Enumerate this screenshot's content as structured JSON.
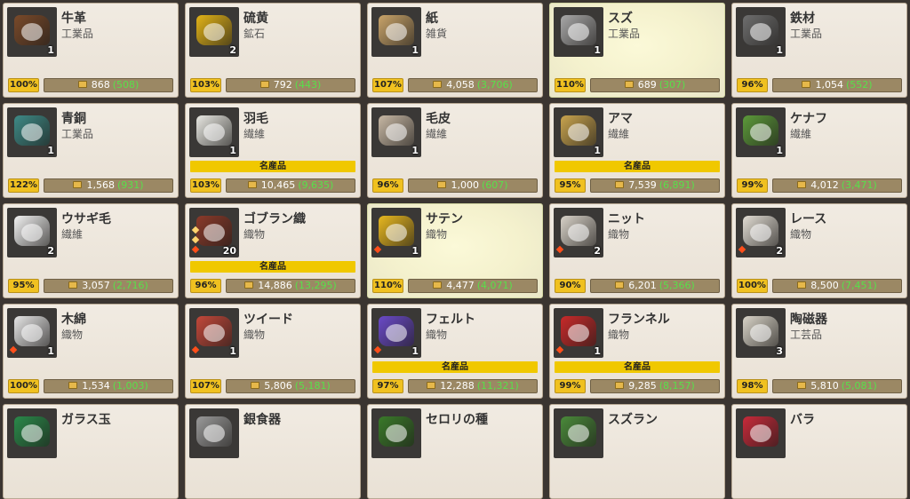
{
  "items": [
    {
      "name": "牛革",
      "category": "工業品",
      "qty": "1",
      "pct": "100%",
      "price": "868",
      "base": "(508)",
      "special": "",
      "highlight": false,
      "gems": 0,
      "color": "#7a4a2a"
    },
    {
      "name": "硫黄",
      "category": "鉱石",
      "qty": "2",
      "pct": "103%",
      "price": "792",
      "base": "(443)",
      "special": "",
      "highlight": false,
      "gems": 0,
      "color": "#e2b318"
    },
    {
      "name": "紙",
      "category": "雑貨",
      "qty": "1",
      "pct": "107%",
      "price": "4,058",
      "base": "(3,706)",
      "special": "",
      "highlight": false,
      "gems": 0,
      "color": "#c9a46a"
    },
    {
      "name": "スズ",
      "category": "工業品",
      "qty": "1",
      "pct": "110%",
      "price": "689",
      "base": "(307)",
      "special": "",
      "highlight": true,
      "gems": 0,
      "color": "#a8a8a8"
    },
    {
      "name": "鉄材",
      "category": "工業品",
      "qty": "1",
      "pct": "96%",
      "price": "1,054",
      "base": "(552)",
      "special": "",
      "highlight": false,
      "gems": 0,
      "color": "#6e6e6e"
    },
    {
      "name": "青銅",
      "category": "工業品",
      "qty": "1",
      "pct": "122%",
      "price": "1,568",
      "base": "(931)",
      "special": "",
      "highlight": false,
      "gems": 0,
      "color": "#3e8a86"
    },
    {
      "name": "羽毛",
      "category": "繊維",
      "qty": "1",
      "pct": "103%",
      "price": "10,465",
      "base": "(9,635)",
      "special": "名産品",
      "highlight": false,
      "gems": 0,
      "color": "#e8e8e2"
    },
    {
      "name": "毛皮",
      "category": "繊維",
      "qty": "1",
      "pct": "96%",
      "price": "1,000",
      "base": "(607)",
      "special": "",
      "highlight": false,
      "gems": 0,
      "color": "#c7b8a4"
    },
    {
      "name": "アマ",
      "category": "繊維",
      "qty": "1",
      "pct": "95%",
      "price": "7,539",
      "base": "(6,891)",
      "special": "名産品",
      "highlight": false,
      "gems": 0,
      "color": "#c9a44e"
    },
    {
      "name": "ケナフ",
      "category": "繊維",
      "qty": "1",
      "pct": "99%",
      "price": "4,012",
      "base": "(3,471)",
      "special": "",
      "highlight": false,
      "gems": 0,
      "color": "#5c9a3a"
    },
    {
      "name": "ウサギ毛",
      "category": "繊維",
      "qty": "2",
      "pct": "95%",
      "price": "3,057",
      "base": "(2,716)",
      "special": "",
      "highlight": false,
      "gems": 0,
      "color": "#f2f2f2"
    },
    {
      "name": "ゴブラン織",
      "category": "織物",
      "qty": "20",
      "pct": "96%",
      "price": "14,886",
      "base": "(13,295)",
      "special": "名産品",
      "highlight": false,
      "gems": 3,
      "color": "#8a3a2a"
    },
    {
      "name": "サテン",
      "category": "織物",
      "qty": "1",
      "pct": "110%",
      "price": "4,477",
      "base": "(4,071)",
      "special": "",
      "highlight": true,
      "gems": 1,
      "color": "#e8b820"
    },
    {
      "name": "ニット",
      "category": "織物",
      "qty": "2",
      "pct": "90%",
      "price": "6,201",
      "base": "(5,366)",
      "special": "",
      "highlight": false,
      "gems": 1,
      "color": "#d8d2c8"
    },
    {
      "name": "レース",
      "category": "織物",
      "qty": "2",
      "pct": "100%",
      "price": "8,500",
      "base": "(7,451)",
      "special": "",
      "highlight": false,
      "gems": 1,
      "color": "#e2ddd4"
    },
    {
      "name": "木綿",
      "category": "織物",
      "qty": "1",
      "pct": "100%",
      "price": "1,534",
      "base": "(1,003)",
      "special": "",
      "highlight": false,
      "gems": 1,
      "color": "#e6e6e6"
    },
    {
      "name": "ツイード",
      "category": "織物",
      "qty": "1",
      "pct": "107%",
      "price": "5,806",
      "base": "(5,181)",
      "special": "",
      "highlight": false,
      "gems": 1,
      "color": "#c2483a"
    },
    {
      "name": "フェルト",
      "category": "織物",
      "qty": "1",
      "pct": "97%",
      "price": "12,288",
      "base": "(11,321)",
      "special": "名産品",
      "highlight": false,
      "gems": 1,
      "color": "#6a4ac8"
    },
    {
      "name": "フランネル",
      "category": "織物",
      "qty": "1",
      "pct": "99%",
      "price": "9,285",
      "base": "(8,157)",
      "special": "名産品",
      "highlight": false,
      "gems": 1,
      "color": "#c82a2a"
    },
    {
      "name": "陶磁器",
      "category": "工芸品",
      "qty": "3",
      "pct": "98%",
      "price": "5,810",
      "base": "(5,081)",
      "special": "",
      "highlight": false,
      "gems": 0,
      "color": "#d9d4c8"
    },
    {
      "name": "ガラス玉",
      "category": "",
      "qty": "",
      "pct": "",
      "price": "",
      "base": "",
      "special": "",
      "highlight": false,
      "gems": 0,
      "color": "#2a8a4a"
    },
    {
      "name": "銀食器",
      "category": "",
      "qty": "",
      "pct": "",
      "price": "",
      "base": "",
      "special": "",
      "highlight": false,
      "gems": 0,
      "color": "#9a9a9a"
    },
    {
      "name": "セロリの種",
      "category": "",
      "qty": "",
      "pct": "",
      "price": "",
      "base": "",
      "special": "",
      "highlight": false,
      "gems": 0,
      "color": "#3a7a2a"
    },
    {
      "name": "スズラン",
      "category": "",
      "qty": "",
      "pct": "",
      "price": "",
      "base": "",
      "special": "",
      "highlight": false,
      "gems": 0,
      "color": "#4a8a3a"
    },
    {
      "name": "バラ",
      "category": "",
      "qty": "",
      "pct": "",
      "price": "",
      "base": "",
      "special": "",
      "highlight": false,
      "gems": 0,
      "color": "#c82a3a"
    }
  ]
}
